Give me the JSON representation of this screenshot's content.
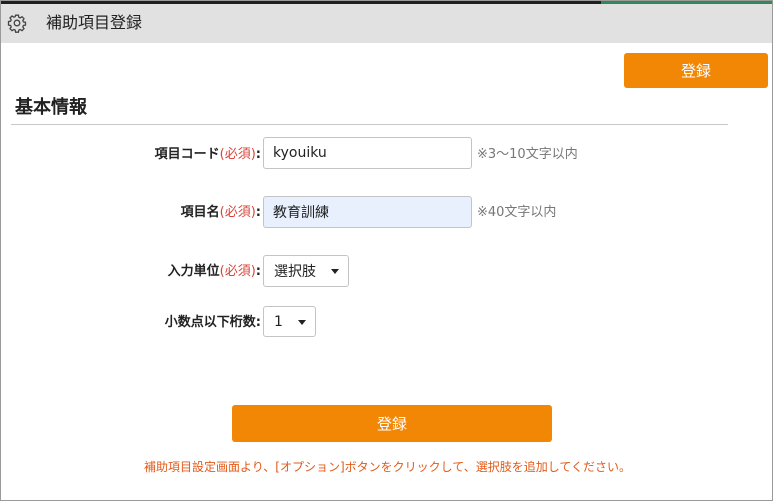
{
  "window": {
    "title": "補助項目登録",
    "icon": "gear-icon"
  },
  "header": {
    "register_label": "登録"
  },
  "section": {
    "title": "基本情報"
  },
  "form": {
    "code": {
      "label": "項目コード",
      "required": "(必須)",
      "colon": ":",
      "value": "kyouiku",
      "hint": "※3～10文字以内"
    },
    "name": {
      "label": "項目名",
      "required": "(必須)",
      "colon": ":",
      "value": "教育訓練",
      "hint": "※40文字以内"
    },
    "unit": {
      "label": "入力単位",
      "required": "(必須)",
      "colon": ":",
      "selected": "選択肢"
    },
    "decimals": {
      "label": "小数点以下桁数",
      "colon": ":",
      "selected": "1"
    }
  },
  "footer": {
    "register_label": "登録",
    "note": "補助項目設定画面より、[オプション]ボタンをクリックして、選択肢を追加してください。"
  },
  "colors": {
    "accent": "#f28705",
    "required": "#d9453a",
    "note": "#e35b1a",
    "titlebar": "#e1e1e1",
    "filled_input": "#e8f0fe"
  }
}
